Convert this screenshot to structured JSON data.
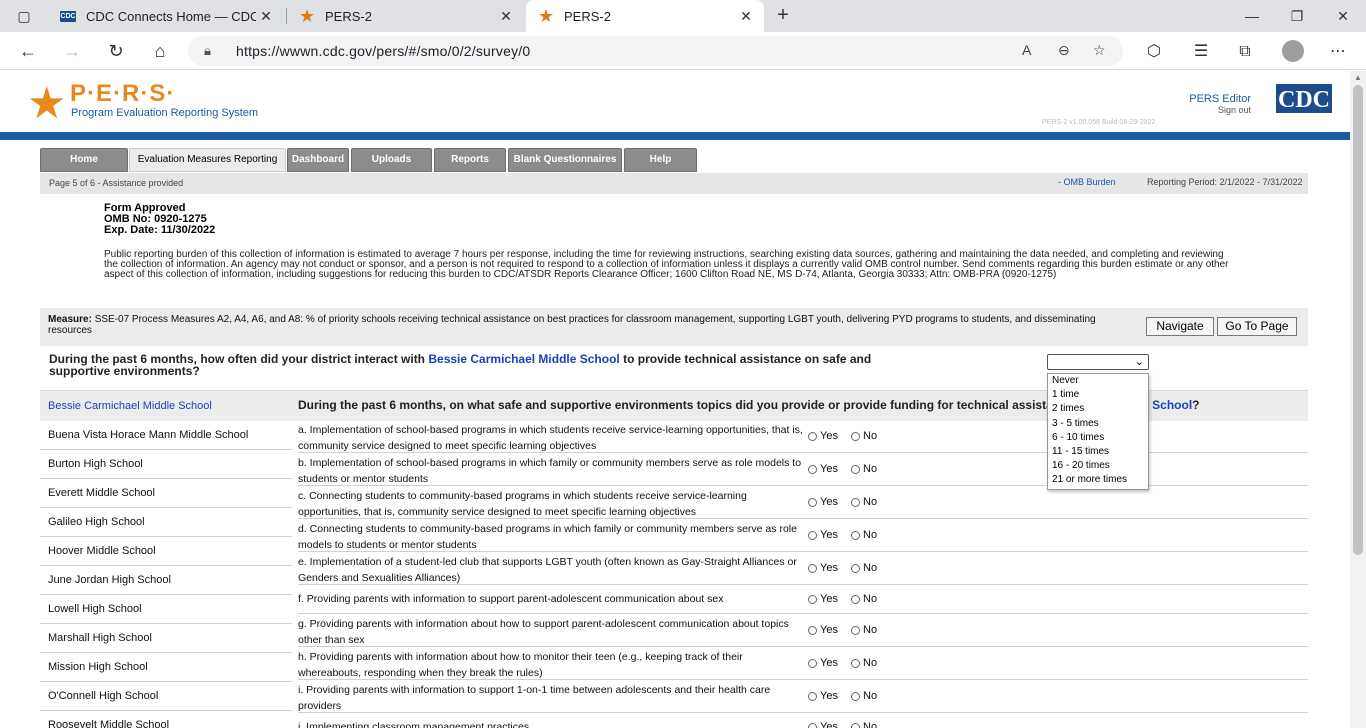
{
  "browser": {
    "tabs": [
      {
        "title": "CDC Connects Home — CDC Co",
        "favicon": "cdc-icon"
      },
      {
        "title": "PERS-2",
        "favicon": "star-icon"
      },
      {
        "title": "PERS-2",
        "favicon": "star-icon"
      }
    ],
    "url": "https://wwwn.cdc.gov/pers/#/smo/0/2/survey/0"
  },
  "header": {
    "logo": "P·E·R·S·",
    "logo_subtitle": "Program Evaluation Reporting System",
    "editor_link": "PERS Editor",
    "signout": "Sign out",
    "version": "PERS-2 v1.00.056    Build 08-29-2022",
    "cdc_logo": "CDC"
  },
  "menu": {
    "items": [
      "Home",
      "Evaluation Measures Reporting",
      "Dashboard",
      "Uploads",
      "Reports",
      "Blank Questionnaires",
      "Help"
    ],
    "active": "Evaluation Measures Reporting"
  },
  "subnav": {
    "page_info": "Page 5 of 6 - Assistance provided",
    "omb_link": "- OMB Burden",
    "reporting_period": "Reporting Period: 2/1/2022 - 7/31/2022"
  },
  "omb": {
    "form_approved": "Form Approved",
    "omb_no": "OMB No: 0920-1275",
    "exp_date": "Exp. Date: 11/30/2022",
    "burden_text": "Public reporting burden of this collection of information is estimated to average 7 hours per response, including the time for reviewing instructions, searching existing data sources, gathering and maintaining the data needed, and completing and reviewing the collection of information. An agency may not conduct or sponsor, and a person is not required to respond to a collection of information unless it displays a currently valid OMB control number. Send comments regarding this burden estimate or any other aspect of this collection of information, including suggestions for reducing this burden to CDC/ATSDR Reports Clearance Officer; 1600 Clifton Road NE, MS D-74, Atlanta, Georgia 30333; Attn: OMB-PRA (0920-1275)"
  },
  "measure": {
    "label": "Measure:",
    "text": "SSE-07 Process Measures A2, A4, A6, and A8: % of priority schools receiving technical assistance on best practices for classroom management, supporting LGBT youth, delivering PYD programs to students, and disseminating resources",
    "navigate_button": "Navigate",
    "goto_button": "Go To Page"
  },
  "question": {
    "prefix": "During the past 6 months, how often did your district interact with ",
    "school_link": "Bessie Carmichael Middle School",
    "suffix": " to provide technical assistance on safe and supportive environments?",
    "select_value": "",
    "options": [
      "Never",
      "1 time",
      "2 times",
      "3 - 5 times",
      "6 - 10 times",
      "11 - 15 times",
      "16 - 20 times",
      "21 or more times"
    ]
  },
  "topics_header": {
    "school": "Bessie Carmichael Middle School",
    "question_prefix": "During the past 6 months, on what safe and supportive environments topics did you provide or provide funding for technical assistance",
    "question_link": "chael Middle School",
    "question_suffix": "?"
  },
  "schools": [
    "Buena Vista Horace Mann Middle School",
    "Burton High School",
    "Everett Middle School",
    "Galileo High School",
    "Hoover Middle School",
    "June Jordan High School",
    "Lowell High School",
    "Marshall High School",
    "Mission High School",
    "O'Connell High School",
    "Roosevelt Middle School"
  ],
  "topics": [
    "a. Implementation of school-based programs in which students receive service-learning opportunities, that is, community service designed to meet specific learning objectives",
    "b. Implementation of school-based programs in which family or community members serve as role models to students or mentor students",
    "c. Connecting students to community-based programs in which students receive service-learning opportunities, that is, community service designed to meet specific learning objectives",
    "d. Connecting students to community-based programs in which family or community members serve as role models to students or mentor students",
    "e. Implementation of a student-led club that supports LGBT youth (often known as Gay-Straight Alliances or Genders and Sexualities Alliances)",
    "f. Providing parents with information to support parent-adolescent communication about sex",
    "g. Providing parents with information about how to support parent-adolescent communication about topics other than sex",
    "h. Providing parents with information about how to monitor their teen (e.g., keeping track of their whereabouts, responding when they break the rules)",
    "i. Providing parents with information to support 1-on-1 time between adolescents and their health care providers",
    "j. Implementing classroom management practices"
  ],
  "radio_labels": {
    "yes": "Yes",
    "no": "No"
  },
  "colors": {
    "accent_blue": "#1c5aa6",
    "logo_orange": "#e8891d",
    "menu_gray": "#8c8c8c"
  }
}
